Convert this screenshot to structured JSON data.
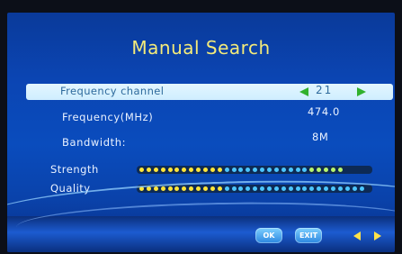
{
  "title": "Manual Search",
  "rows": {
    "frequency_channel": {
      "label": "Frequency channel",
      "value": "21"
    },
    "frequency": {
      "label": "Frequency(MHz)",
      "value": "474.0"
    },
    "bandwidth": {
      "label": "Bandwidth:",
      "value": "8M"
    }
  },
  "meters": {
    "strength": {
      "label": "Strength",
      "level": 0.92,
      "segments": 32,
      "yellow": 12,
      "blue": 12,
      "green": 8
    },
    "quality": {
      "label": "Quality",
      "level": 1.0,
      "segments": 32,
      "yellow": 12,
      "blue": 20,
      "green": 0
    }
  },
  "buttons": {
    "ok": "OK",
    "exit": "EXIT"
  },
  "icons": {
    "left_arrow": "triangle-left",
    "right_arrow": "triangle-right",
    "nav_left": "triangle-left",
    "nav_right": "triangle-right"
  },
  "colors": {
    "title": "#f4eb7a",
    "arrow": "#31b12d",
    "dot_yellow": "#ffe53a",
    "dot_blue": "#4cc6ff",
    "dot_green": "#b7f46d"
  }
}
